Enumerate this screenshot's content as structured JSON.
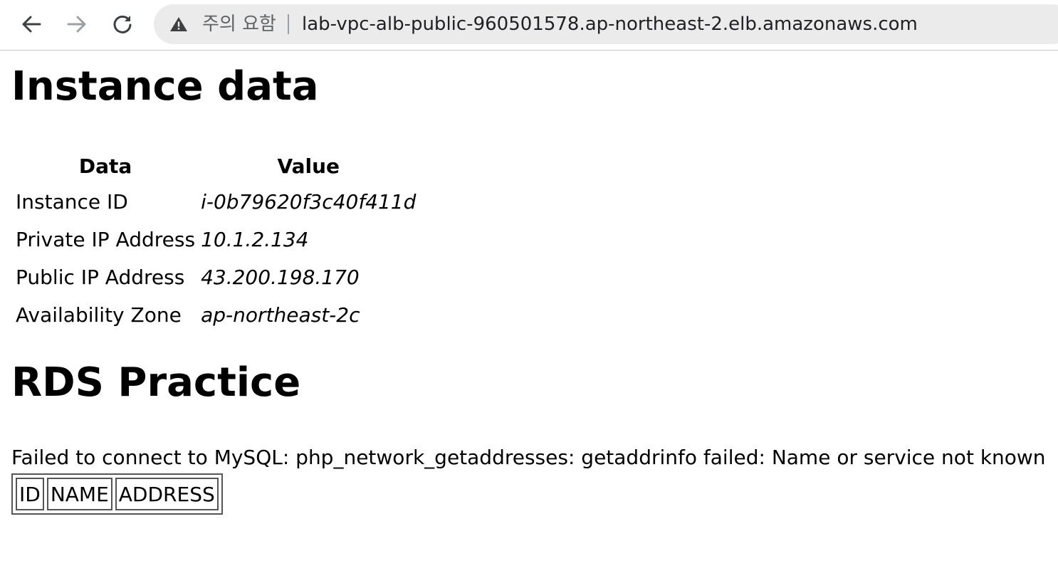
{
  "browser": {
    "security_label": "주의 요함",
    "url": "lab-vpc-alb-public-960501578.ap-northeast-2.elb.amazonaws.com",
    "icons": [
      "back-arrow-icon",
      "forward-arrow-icon",
      "reload-icon",
      "warning-icon"
    ]
  },
  "page": {
    "instance_heading": "Instance data",
    "instance_table": {
      "headers": [
        "Data",
        "Value"
      ],
      "rows": [
        {
          "label": "Instance ID",
          "value": "i-0b79620f3c40f411d"
        },
        {
          "label": "Private IP Address",
          "value": "10.1.2.134"
        },
        {
          "label": "Public IP Address",
          "value": "43.200.198.170"
        },
        {
          "label": "Availability Zone",
          "value": "ap-northeast-2c"
        }
      ]
    },
    "rds_heading": "RDS Practice",
    "error_message": "Failed to connect to MySQL: php_network_getaddresses: getaddrinfo failed: Name or service not known",
    "rds_table": {
      "headers": [
        "ID",
        "NAME",
        "ADDRESS"
      ]
    }
  }
}
